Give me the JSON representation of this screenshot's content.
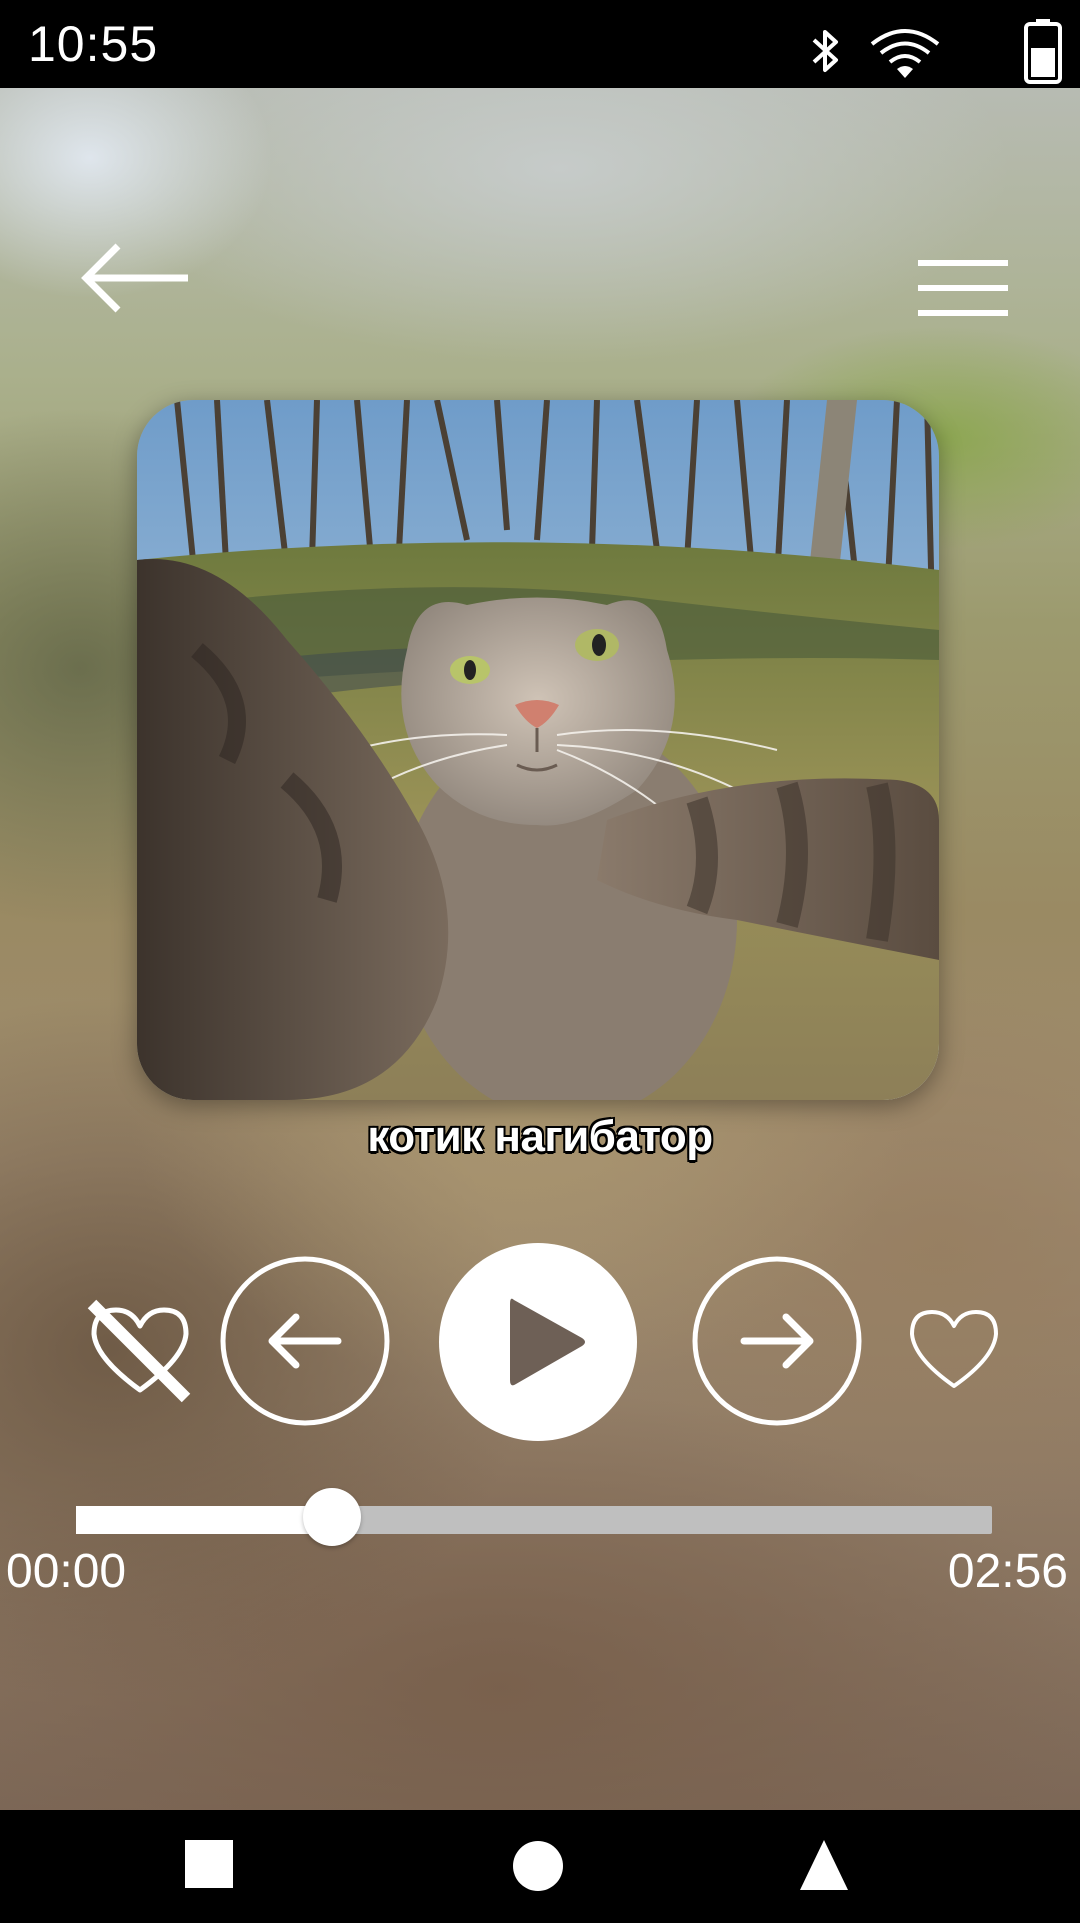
{
  "status_bar": {
    "time": "10:55",
    "icons": [
      "bluetooth-icon",
      "wifi-icon",
      "battery-icon"
    ]
  },
  "header": {
    "back_icon": "arrow-left-icon",
    "menu_icon": "hamburger-menu-icon"
  },
  "track": {
    "title": "котик нагибатор",
    "artwork": "cat-selfie-photo"
  },
  "controls": {
    "dislike_icon": "heart-crossed-icon",
    "prev_icon": "arrow-left-circle-icon",
    "play_icon": "play-icon",
    "next_icon": "arrow-right-circle-icon",
    "like_icon": "heart-outline-icon"
  },
  "progress": {
    "elapsed": "00:00",
    "total": "02:56",
    "fraction": 0.28
  },
  "nav_bar": {
    "recents_icon": "square-icon",
    "home_icon": "circle-icon",
    "back_icon": "triangle-icon"
  },
  "colors": {
    "status_bar_bg": "#000000",
    "accent": "#ffffff",
    "track_unfilled": "#bfbfbf"
  }
}
